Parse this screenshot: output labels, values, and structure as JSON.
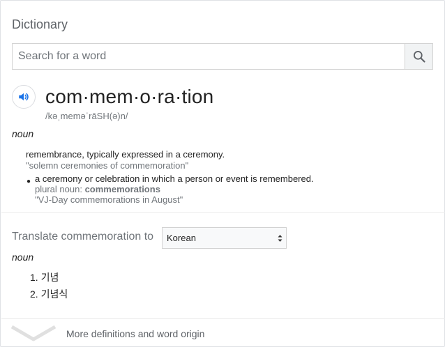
{
  "header": {
    "title": "Dictionary"
  },
  "search": {
    "placeholder": "Search for a word",
    "value": ""
  },
  "entry": {
    "headword": "com·mem·o·ra·tion",
    "phonetic": "/kəˌmeməˈrāSH(ə)n/",
    "part_of_speech": "noun",
    "senses": [
      {
        "definition": "remembrance, typically expressed in a ceremony.",
        "example": "\"solemn ceremonies of commemoration\""
      },
      {
        "definition": "a ceremony or celebration in which a person or event is remembered.",
        "plural_label": "plural noun: ",
        "plural_value": "commemorations",
        "example": "\"VJ-Day commemorations in August\""
      }
    ]
  },
  "translate": {
    "label": "Translate commemoration to",
    "language": "Korean",
    "part_of_speech": "noun",
    "items": [
      "1. 기념",
      "2. 기념식"
    ]
  },
  "footer": {
    "more_label": "More definitions and word origin"
  },
  "icons": {
    "search": "search-icon",
    "speaker": "speaker-icon",
    "expand": "chevron-down-icon",
    "select": "select-arrows-icon"
  },
  "colors": {
    "accent": "#1a73e8",
    "muted": "#70757a",
    "border": "#dfe1e5"
  }
}
